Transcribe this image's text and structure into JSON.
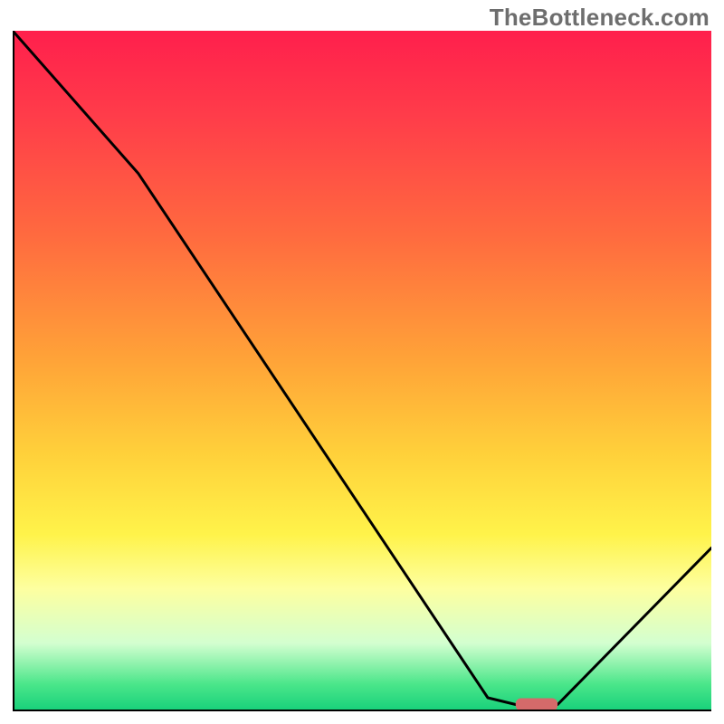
{
  "watermark": "TheBottleneck.com",
  "chart_data": {
    "type": "line",
    "title": "",
    "xlabel": "",
    "ylabel": "",
    "xlim": [
      0,
      100
    ],
    "ylim": [
      0,
      100
    ],
    "series": [
      {
        "name": "bottleneck-curve",
        "x": [
          0,
          18,
          68,
          72,
          78,
          100
        ],
        "y": [
          100,
          79,
          2,
          1,
          1,
          24
        ]
      }
    ],
    "marker": {
      "name": "optimal-range",
      "x_start": 72,
      "x_end": 78,
      "y": 1,
      "color": "#d46a6a"
    },
    "gradient_stops": [
      {
        "pos": 0.0,
        "color": "#ff1f4c"
      },
      {
        "pos": 0.12,
        "color": "#ff3b4a"
      },
      {
        "pos": 0.3,
        "color": "#ff6a3f"
      },
      {
        "pos": 0.48,
        "color": "#ffa238"
      },
      {
        "pos": 0.62,
        "color": "#ffd03a"
      },
      {
        "pos": 0.74,
        "color": "#fff34a"
      },
      {
        "pos": 0.82,
        "color": "#fdffa0"
      },
      {
        "pos": 0.9,
        "color": "#d3ffd0"
      },
      {
        "pos": 0.96,
        "color": "#4be68a"
      },
      {
        "pos": 1.0,
        "color": "#16d07a"
      }
    ]
  }
}
